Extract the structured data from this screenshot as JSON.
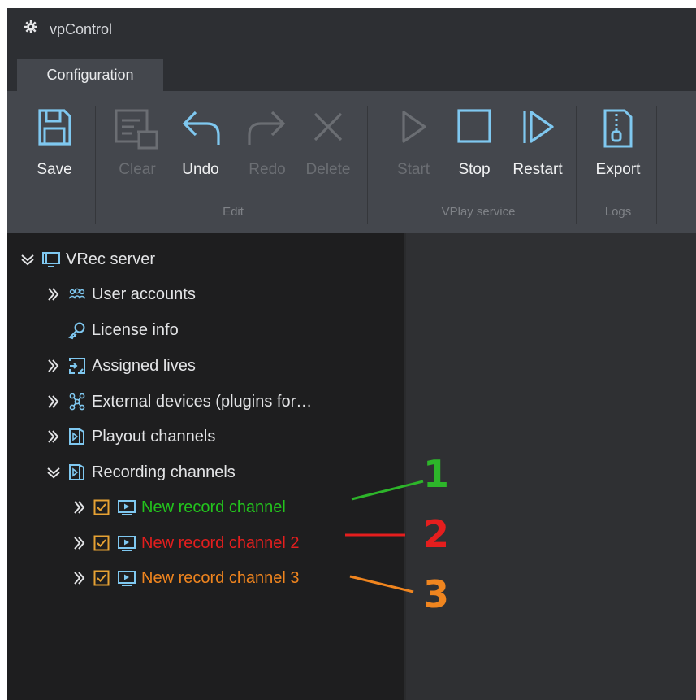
{
  "window": {
    "title": "vpControl",
    "tab": "Configuration"
  },
  "ribbon": {
    "buttons": {
      "save": "Save",
      "clear": "Clear",
      "undo": "Undo",
      "redo": "Redo",
      "delete": "Delete",
      "start": "Start",
      "stop": "Stop",
      "restart": "Restart",
      "export": "Export"
    },
    "groups": {
      "edit": "Edit",
      "vplay": "VPlay service",
      "logs": "Logs"
    }
  },
  "tree": {
    "root": "VRec server",
    "items": [
      {
        "label": "User accounts",
        "icon": "users-icon"
      },
      {
        "label": "License info",
        "icon": "key-icon"
      },
      {
        "label": "Assigned lives",
        "icon": "assign-icon"
      },
      {
        "label": "External devices (plugins for…",
        "icon": "plugin-icon"
      },
      {
        "label": "Playout channels",
        "icon": "channel-folder-icon"
      },
      {
        "label": "Recording channels",
        "icon": "channel-folder-icon"
      }
    ],
    "channels": [
      {
        "label": "New record channel",
        "color": "#23c41d"
      },
      {
        "label": "New record channel 2",
        "color": "#e51e1e"
      },
      {
        "label": "New record channel 3",
        "color": "#f0851f"
      }
    ]
  },
  "annotations": [
    {
      "text": "1",
      "color": "#2db52a"
    },
    {
      "text": "2",
      "color": "#e51e1e"
    },
    {
      "text": "3",
      "color": "#f0851f"
    }
  ],
  "colors": {
    "accent": "#7fc8f0",
    "checkbox": "#e7a233",
    "background": "#1e1e1f"
  }
}
